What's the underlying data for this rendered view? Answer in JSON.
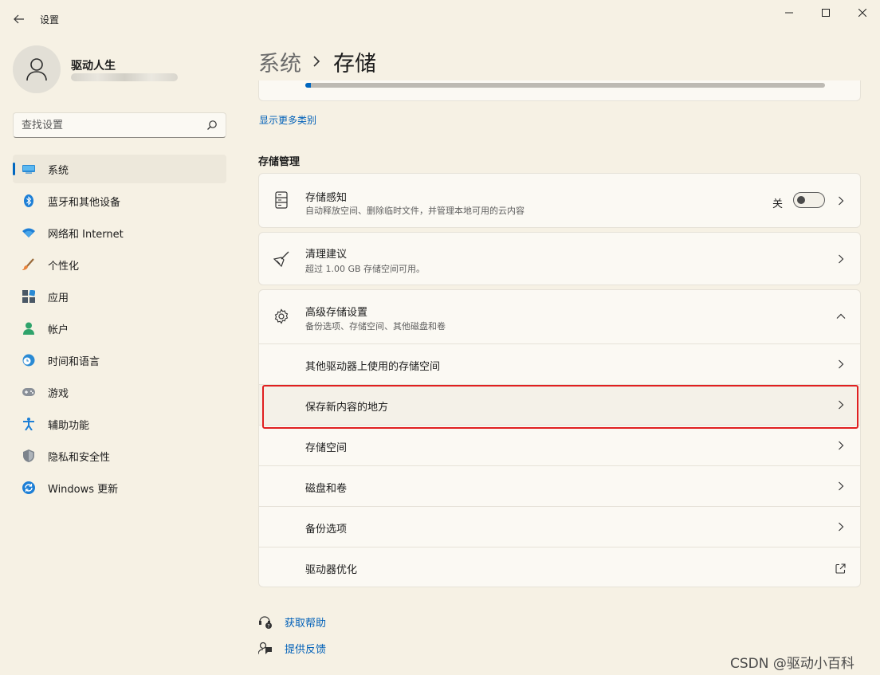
{
  "window": {
    "title": "设置",
    "controls": {
      "minimize": "minimize-icon",
      "maximize": "maximize-icon",
      "close": "close-icon"
    }
  },
  "user": {
    "name": "驱动人生",
    "avatar_icon": "person-icon"
  },
  "search": {
    "placeholder": "查找设置",
    "icon": "search-icon"
  },
  "nav": {
    "items": [
      {
        "label": "系统",
        "icon": "monitor-icon",
        "active": true
      },
      {
        "label": "蓝牙和其他设备",
        "icon": "bluetooth-icon"
      },
      {
        "label": "网络和 Internet",
        "icon": "wifi-icon"
      },
      {
        "label": "个性化",
        "icon": "brush-icon"
      },
      {
        "label": "应用",
        "icon": "apps-icon"
      },
      {
        "label": "帐户",
        "icon": "account-icon"
      },
      {
        "label": "时间和语言",
        "icon": "globe-clock-icon"
      },
      {
        "label": "游戏",
        "icon": "gamepad-icon"
      },
      {
        "label": "辅助功能",
        "icon": "accessibility-icon"
      },
      {
        "label": "隐私和安全性",
        "icon": "shield-icon"
      },
      {
        "label": "Windows 更新",
        "icon": "update-icon"
      }
    ]
  },
  "header": {
    "parent": "系统",
    "current": "存储"
  },
  "storage_bar": {
    "used_fraction": 0.01
  },
  "more_categories_label": "显示更多类别",
  "storage_management": {
    "title": "存储管理",
    "storage_sense": {
      "title": "存储感知",
      "desc": "自动释放空间、删除临时文件，并管理本地可用的云内容",
      "toggle_label": "关",
      "toggle_on": false
    },
    "cleanup": {
      "title": "清理建议",
      "desc": "超过 1.00 GB 存储空间可用。"
    },
    "advanced": {
      "title": "高级存储设置",
      "desc": "备份选项、存储空间、其他磁盘和卷",
      "expanded": true,
      "items": [
        {
          "label": "其他驱动器上使用的存储空间"
        },
        {
          "label": "保存新内容的地方",
          "highlighted": true
        },
        {
          "label": "存储空间"
        },
        {
          "label": "磁盘和卷"
        },
        {
          "label": "备份选项"
        },
        {
          "label": "驱动器优化",
          "external": true
        }
      ]
    }
  },
  "footer": {
    "help": "获取帮助",
    "feedback": "提供反馈"
  },
  "watermark": "CSDN @驱动小百科",
  "colors": {
    "accent": "#0067c0",
    "link": "#0060b8",
    "highlight_border": "#e02020",
    "background": "#f6f1e4"
  }
}
